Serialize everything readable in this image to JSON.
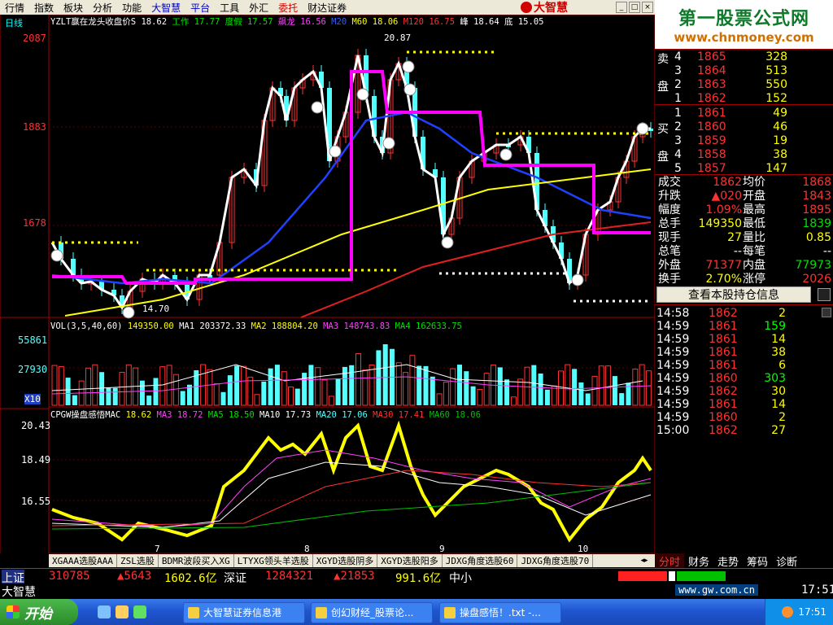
{
  "menu": [
    "行情",
    "指数",
    "板块",
    "分析",
    "功能",
    "大智慧",
    "平台",
    "工具",
    "外汇",
    "委托",
    "财达证券"
  ],
  "logo_text": "大智慧",
  "brand": {
    "line1": "第一股票公式网",
    "line2": "www.chnmoney.com"
  },
  "period": "日线",
  "main_header": {
    "p1": "YZLT赢在龙头收盘价S",
    "p1v": "18.62",
    "p2": "工作",
    "p2v": "17.77",
    "p3": "度假",
    "p3v": "17.57",
    "p4": "飙龙",
    "p4v": "16.56",
    "p5": "M20",
    "p6": "M60",
    "p6v": "18.06",
    "p7": "M120",
    "p7v": "16.75",
    "p8": "峰",
    "p8v": "18.64",
    "p9": "底",
    "p9v": "15.05"
  },
  "price_axis": [
    "2087",
    "1883",
    "1678"
  ],
  "peak_label": "20.87",
  "low_label": "14.70",
  "vol_header": {
    "a": "VOL(3,5,40,60)",
    "av": "149350.00",
    "b": "MA1",
    "bv": "203372.33",
    "c": "MA2",
    "cv": "188804.20",
    "d": "MA3",
    "dv": "148743.83",
    "e": "MA4",
    "ev": "162633.75"
  },
  "vol_axis": [
    "55861",
    "27930",
    "X10"
  ],
  "mac_header": {
    "a": "CPGW操盘感悟MAC",
    "av": "18.62",
    "b": "MA3",
    "bv": "18.72",
    "c": "MA5",
    "cv": "18.50",
    "d": "MA10",
    "dv": "17.73",
    "e": "MA20",
    "ev": "17.06",
    "f": "MA30",
    "fv": "17.41",
    "g": "MA60",
    "gv": "18.06"
  },
  "mac_axis": [
    "20.43",
    "18.49",
    "16.55"
  ],
  "x_ticks": [
    "7",
    "8",
    "9",
    "10"
  ],
  "order_book": {
    "sell_label": [
      "卖",
      "盘"
    ],
    "buy_label": [
      "买",
      "盘"
    ],
    "sell": [
      {
        "n": "4",
        "p": "1865",
        "v": "328"
      },
      {
        "n": "3",
        "p": "1864",
        "v": "513"
      },
      {
        "n": "2",
        "p": "1863",
        "v": "550"
      },
      {
        "n": "1",
        "p": "1862",
        "v": "152"
      }
    ],
    "buy": [
      {
        "n": "1",
        "p": "1861",
        "v": "49"
      },
      {
        "n": "2",
        "p": "1860",
        "v": "46"
      },
      {
        "n": "3",
        "p": "1859",
        "v": "19"
      },
      {
        "n": "4",
        "p": "1858",
        "v": "38"
      },
      {
        "n": "5",
        "p": "1857",
        "v": "147"
      }
    ]
  },
  "stats": [
    {
      "l": "成交",
      "v": "1862",
      "l2": "均价",
      "v2": "1868"
    },
    {
      "l": "升跌",
      "v": "▲020",
      "l2": "开盘",
      "v2": "1843"
    },
    {
      "l": "幅度",
      "v": "1.09%",
      "l2": "最高",
      "v2": "1895"
    },
    {
      "l": "总手",
      "v": "149350",
      "l2": "最低",
      "v2": "1839"
    },
    {
      "l": "现手",
      "v": "27",
      "l2": "量比",
      "v2": "0.85"
    },
    {
      "l": "总笔",
      "v": "--",
      "l2": "每笔",
      "v2": "--"
    },
    {
      "l": "外盘",
      "v": "71377",
      "l2": "内盘",
      "v2": "77973"
    },
    {
      "l": "换手",
      "v": "2.70%",
      "l2": "涨停",
      "v2": "2026"
    }
  ],
  "hold_button": "查看本股持仓信息",
  "ticks": [
    {
      "t": "14:58",
      "p": "1862",
      "v": "2"
    },
    {
      "t": "14:59",
      "p": "1861",
      "v": "159"
    },
    {
      "t": "14:59",
      "p": "1861",
      "v": "14"
    },
    {
      "t": "14:59",
      "p": "1861",
      "v": "38"
    },
    {
      "t": "14:59",
      "p": "1861",
      "v": "6"
    },
    {
      "t": "14:59",
      "p": "1860",
      "v": "303"
    },
    {
      "t": "14:59",
      "p": "1862",
      "v": "30"
    },
    {
      "t": "14:59",
      "p": "1861",
      "v": "14"
    },
    {
      "t": "14:59",
      "p": "1860",
      "v": "2"
    },
    {
      "t": "15:00",
      "p": "1862",
      "v": "27"
    }
  ],
  "bottom_tabs": [
    "XGAAA选股AAA",
    "ZSL选股",
    "BDMR波段买入XG",
    "LTYXG领头羊选股",
    "XGYD选股阴多",
    "XGYD选股阳多",
    "JDXG角度选股60",
    "JDXG角度选股70"
  ],
  "right_tabs": [
    "分时",
    "财务",
    "走势",
    "筹码",
    "诊断"
  ],
  "status": {
    "sh": "上证",
    "shv": "310785",
    "shc": "▲5643",
    "sha": "1602.6亿",
    "sz": "深证",
    "szv": "1284321",
    "szc": "▲21853",
    "sza": "991.6亿",
    "zx": "中小"
  },
  "status2": {
    "name": "大智慧",
    "url": "www.gw.com.cn",
    "time": "17:51"
  },
  "taskbar": {
    "start": "开始",
    "items": [
      "大智慧证券信息港",
      "创幻财经_股票论...",
      "操盘感悟！.txt -..."
    ],
    "clock": "17:51"
  },
  "colors": {
    "up": "#ff3232",
    "down": "#54ffff",
    "yellow": "#ffff00",
    "magenta": "#ff00ff",
    "green": "#00d200"
  }
}
